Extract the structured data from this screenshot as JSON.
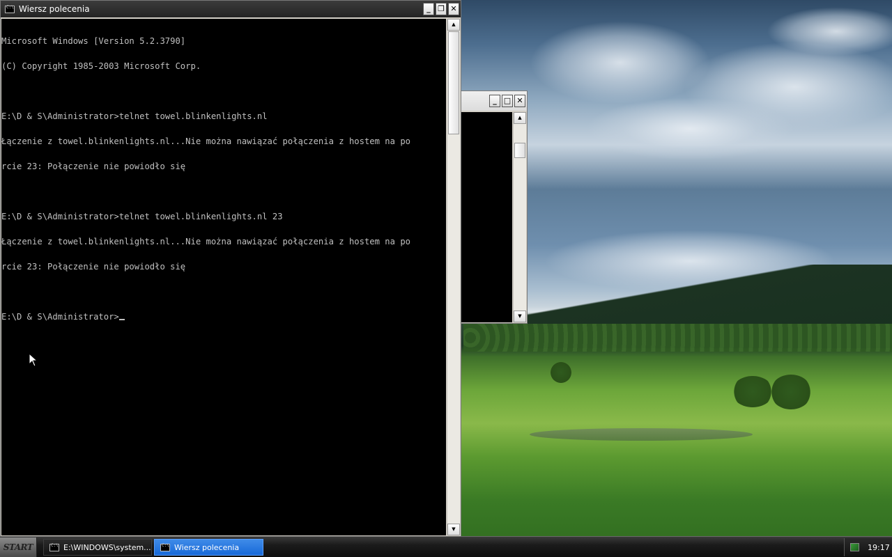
{
  "main_window": {
    "title": "Wiersz polecenia",
    "lines": [
      "Microsoft Windows [Version 5.2.3790]",
      "(C) Copyright 1985-2003 Microsoft Corp.",
      "",
      "E:\\D & S\\Administrator>telnet towel.blinkenlights.nl",
      "Łączenie z towel.blinkenlights.nl...Nie można nawiązać połączenia z hostem na po",
      "rcie 23: Połączenie nie powiodło się",
      "",
      "E:\\D & S\\Administrator>telnet towel.blinkenlights.nl 23",
      "Łączenie z towel.blinkenlights.nl...Nie można nawiązać połączenia z hostem na po",
      "rcie 23: Połączenie nie powiodło się",
      ""
    ],
    "prompt": "E:\\D & S\\Administrator>"
  },
  "taskbar": {
    "start_label": "START",
    "tasks": [
      {
        "label": "E:\\WINDOWS\\system...",
        "active": false
      },
      {
        "label": "Wiersz polecenia",
        "active": true
      }
    ],
    "clock": "19:17"
  },
  "icons": {
    "minimize": "minimize-icon",
    "maximize": "maximize-icon",
    "restore": "restore-icon",
    "close": "close-icon",
    "console": "console-icon"
  },
  "colors": {
    "console_bg": "#000000",
    "console_fg": "#c0c0c0",
    "active_task": "#1f6fdc"
  }
}
